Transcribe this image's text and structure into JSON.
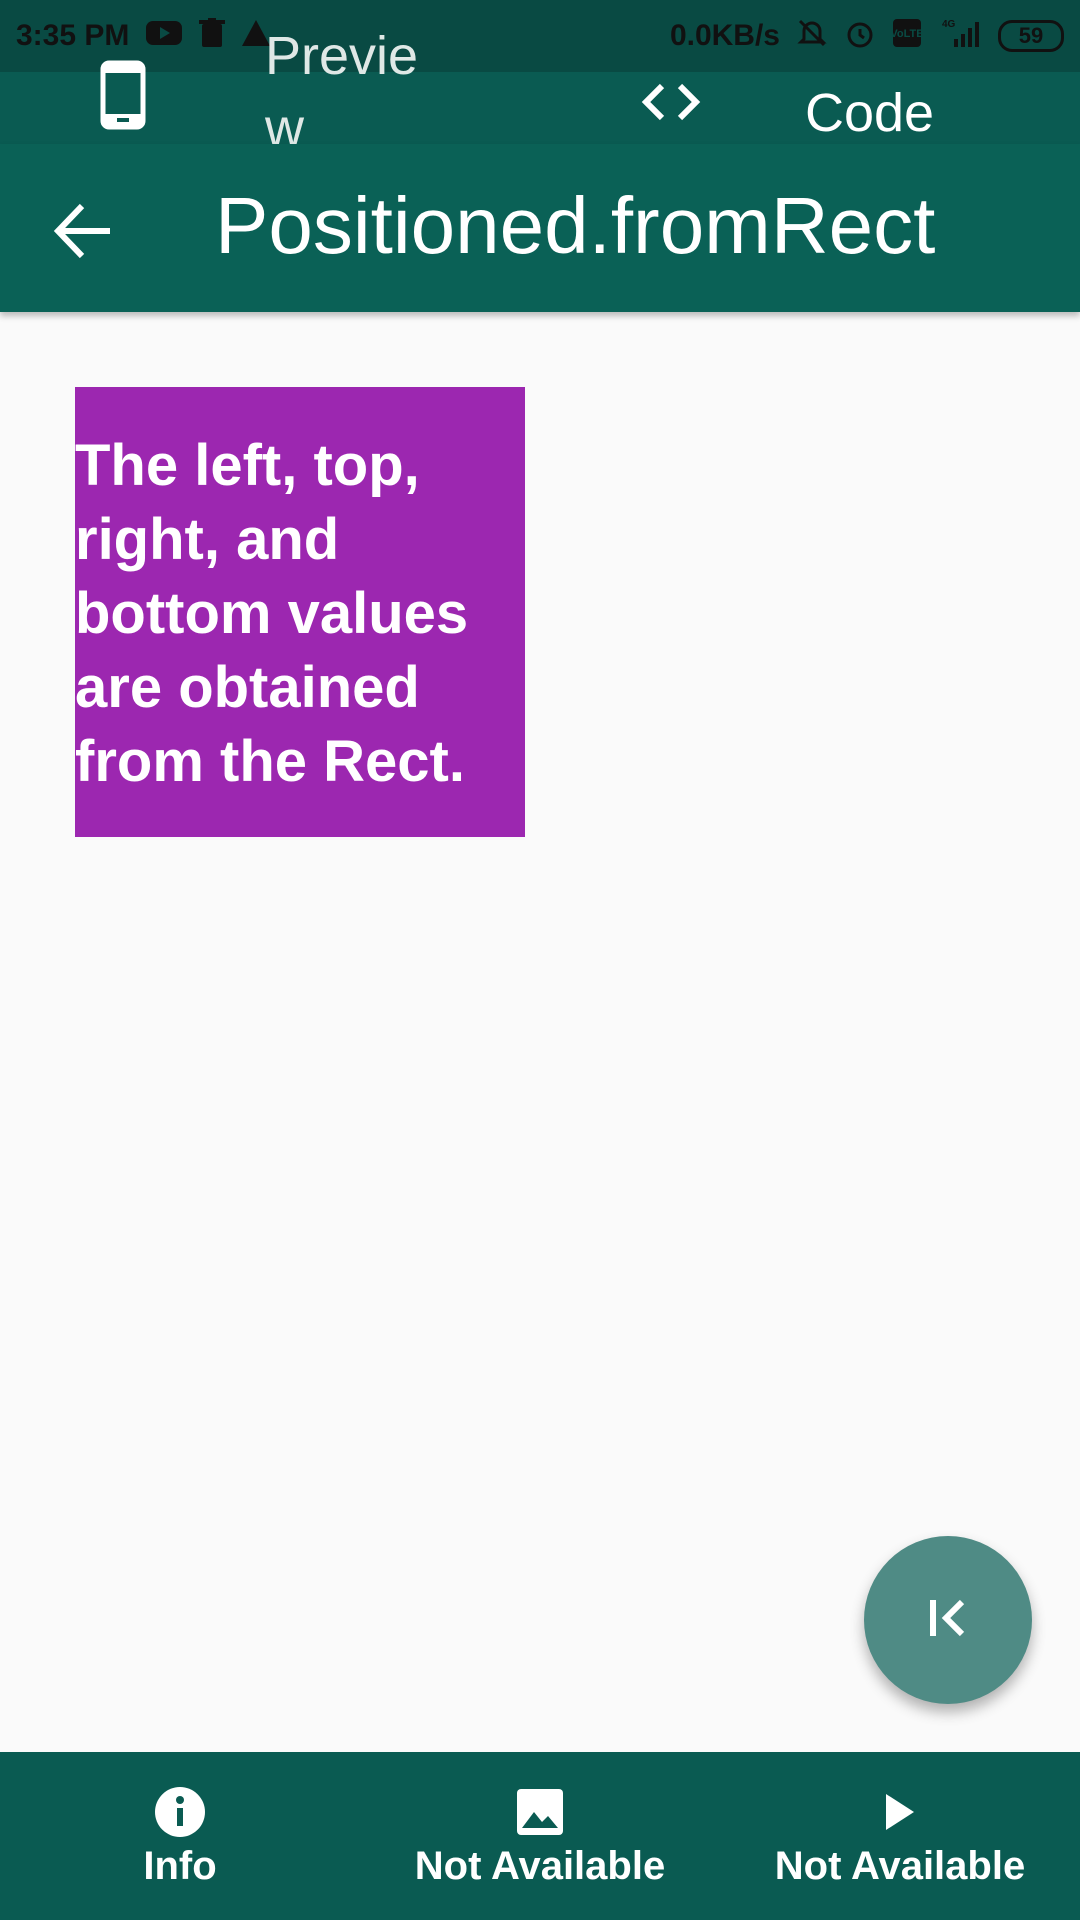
{
  "status_bar": {
    "time": "3:35 PM",
    "network_speed": "0.0KB/s",
    "network_type": "4G",
    "volte": "VoLTE",
    "battery": "59",
    "left_icons": [
      "youtube-icon",
      "trash-icon",
      "warning-icon"
    ],
    "right_icons": [
      "mute-icon",
      "alarm-icon",
      "volte-icon",
      "signal-icon",
      "battery-icon"
    ]
  },
  "tabs": {
    "preview_label": "Preview",
    "code_label": "Code"
  },
  "appbar": {
    "title": "Positioned.fromRect",
    "back_icon": "arrow-back-icon"
  },
  "content": {
    "box_text": "The left, top, right, and bottom values are obtained from the Rect.",
    "box_color": "#9c27b0"
  },
  "fab": {
    "icon": "first-page-icon"
  },
  "bottom_nav": [
    {
      "label": "Info",
      "icon": "info-icon"
    },
    {
      "label": "Not Available",
      "icon": "image-icon"
    },
    {
      "label": "Not Available",
      "icon": "play-icon"
    }
  ],
  "colors": {
    "primary": "#0a6156",
    "primary_dark": "#094a43",
    "fab": "#4f8b85",
    "background": "#fafafa"
  }
}
